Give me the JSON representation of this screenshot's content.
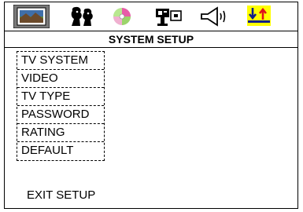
{
  "tabs": [
    {
      "icon": "tv-picture-icon",
      "selected": true
    },
    {
      "icon": "people-icon",
      "selected": false
    },
    {
      "icon": "disc-icon",
      "selected": false
    },
    {
      "icon": "speaker-settings-icon",
      "selected": false
    },
    {
      "icon": "audio-speaker-icon",
      "selected": false
    },
    {
      "icon": "preference-arrows-icon",
      "selected": false
    }
  ],
  "title": "SYSTEM SETUP",
  "menu": {
    "items": [
      "TV SYSTEM",
      "VIDEO",
      "TV TYPE",
      "PASSWORD",
      "RATING",
      "DEFAULT"
    ]
  },
  "exit_label": "EXIT SETUP",
  "colors": {
    "selected_tab": "#7a7a7a",
    "preference_tab_bg": "#ffff00",
    "arrow_red": "#e0101a",
    "arrow_blue": "#0f1f8a"
  }
}
